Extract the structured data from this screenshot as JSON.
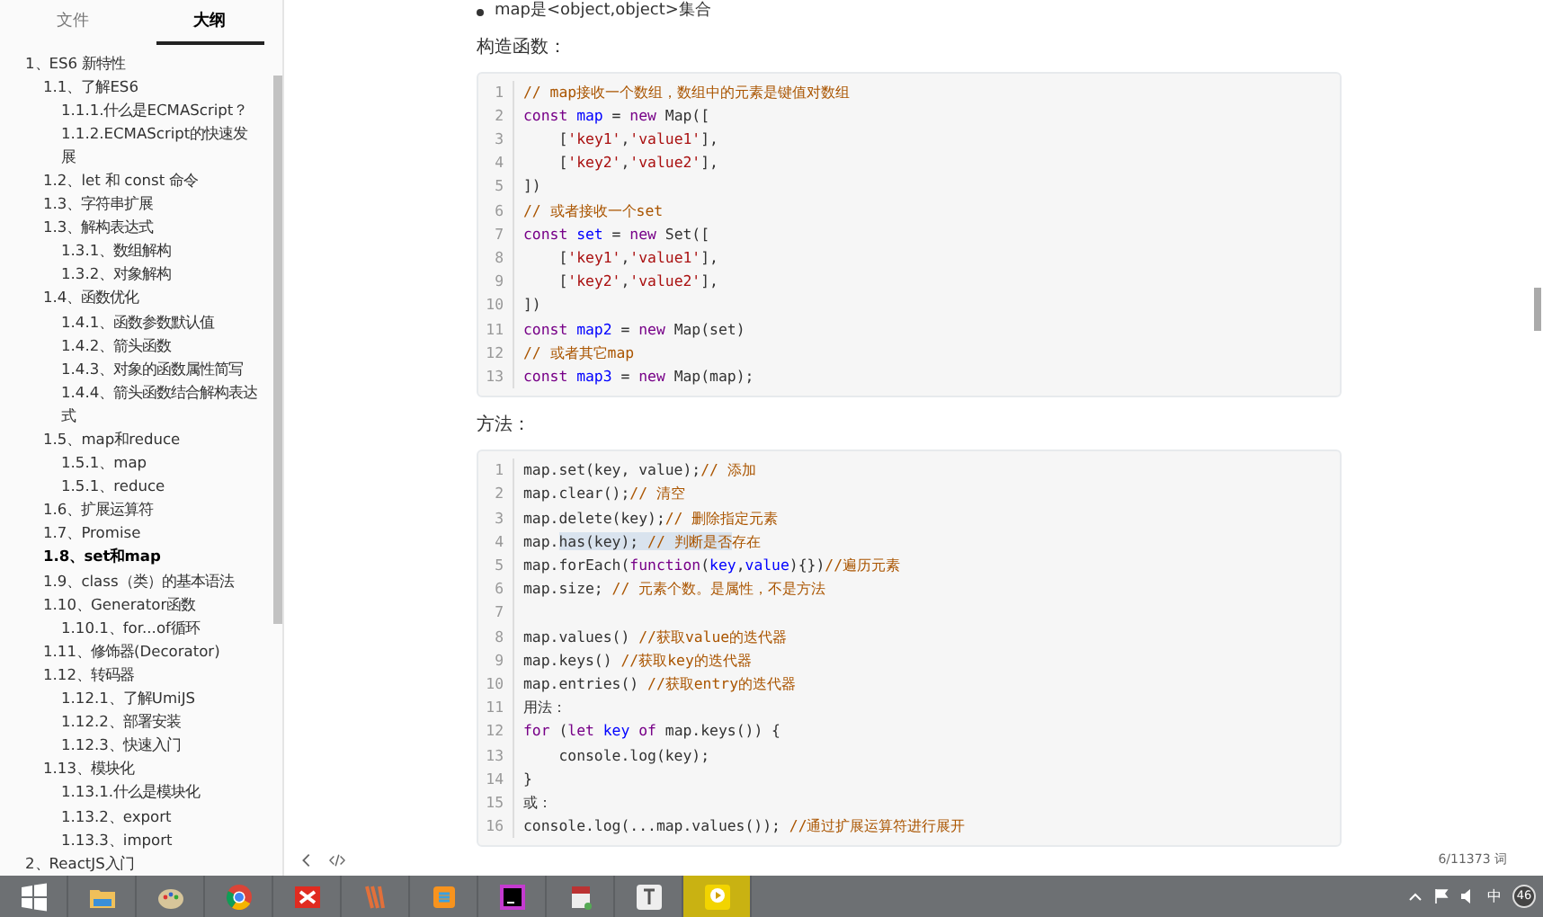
{
  "sidebar": {
    "tabs": [
      {
        "label": "文件",
        "selected": false
      },
      {
        "label": "大纲",
        "selected": true
      }
    ],
    "outline": [
      {
        "label": "1、ES6 新特性",
        "selected": false,
        "children": [
          {
            "label": "1.1、了解ES6",
            "selected": false,
            "children": [
              {
                "label": "1.1.1.什么是ECMAScript？",
                "selected": false
              },
              {
                "label": "1.1.2.ECMAScript的快速发展",
                "selected": false
              }
            ]
          },
          {
            "label": "1.2、let 和 const 命令",
            "selected": false
          },
          {
            "label": "1.3、字符串扩展",
            "selected": false
          },
          {
            "label": "1.3、解构表达式",
            "selected": false,
            "children": [
              {
                "label": "1.3.1、数组解构",
                "selected": false
              },
              {
                "label": "1.3.2、对象解构",
                "selected": false
              }
            ]
          },
          {
            "label": "1.4、函数优化",
            "selected": false,
            "children": [
              {
                "label": "1.4.1、函数参数默认值",
                "selected": false
              },
              {
                "label": "1.4.2、箭头函数",
                "selected": false
              },
              {
                "label": "1.4.3、对象的函数属性简写",
                "selected": false
              },
              {
                "label": "1.4.4、箭头函数结合解构表达式",
                "selected": false
              }
            ]
          },
          {
            "label": "1.5、map和reduce",
            "selected": false,
            "children": [
              {
                "label": "1.5.1、map",
                "selected": false
              },
              {
                "label": "1.5.1、reduce",
                "selected": false
              }
            ]
          },
          {
            "label": "1.6、扩展运算符",
            "selected": false
          },
          {
            "label": "1.7、Promise",
            "selected": false
          },
          {
            "label": "1.8、set和map",
            "selected": true
          },
          {
            "label": "1.9、class（类）的基本语法",
            "selected": false
          },
          {
            "label": "1.10、Generator函数",
            "selected": false,
            "children": [
              {
                "label": "1.10.1、for...of循环",
                "selected": false
              }
            ]
          },
          {
            "label": "1.11、修饰器(Decorator)",
            "selected": false
          },
          {
            "label": "1.12、转码器",
            "selected": false,
            "children": [
              {
                "label": "1.12.1、了解UmiJS",
                "selected": false
              },
              {
                "label": "1.12.2、部署安装",
                "selected": false
              },
              {
                "label": "1.12.3、快速入门",
                "selected": false
              }
            ]
          },
          {
            "label": "1.13、模块化",
            "selected": false,
            "children": [
              {
                "label": "1.13.1.什么是模块化",
                "selected": false
              },
              {
                "label": "1.13.2、export",
                "selected": false
              },
              {
                "label": "1.13.3、import",
                "selected": false
              }
            ]
          }
        ]
      },
      {
        "label": "2、ReactJS入门",
        "selected": false
      }
    ]
  },
  "document": {
    "bullet": "map是<object,object>集合",
    "sections": [
      {
        "heading": "构造函数：",
        "code": [
          {
            "number": "1",
            "tokens": [
              {
                "kind": "comment",
                "text": "// map接收一个数组，数组中的元素是键值对数组"
              }
            ]
          },
          {
            "number": "2",
            "tokens": [
              {
                "kind": "keyword",
                "text": "const "
              },
              {
                "kind": "def",
                "text": "map"
              },
              {
                "kind": "plain",
                "text": " = "
              },
              {
                "kind": "keyword",
                "text": "new"
              },
              {
                "kind": "plain",
                "text": " Map(["
              }
            ]
          },
          {
            "number": "3",
            "tokens": [
              {
                "kind": "plain",
                "text": "    ["
              },
              {
                "kind": "string",
                "text": "'key1'"
              },
              {
                "kind": "plain",
                "text": ","
              },
              {
                "kind": "string",
                "text": "'value1'"
              },
              {
                "kind": "plain",
                "text": "],"
              }
            ]
          },
          {
            "number": "4",
            "tokens": [
              {
                "kind": "plain",
                "text": "    ["
              },
              {
                "kind": "string",
                "text": "'key2'"
              },
              {
                "kind": "plain",
                "text": ","
              },
              {
                "kind": "string",
                "text": "'value2'"
              },
              {
                "kind": "plain",
                "text": "],"
              }
            ]
          },
          {
            "number": "5",
            "tokens": [
              {
                "kind": "plain",
                "text": "])"
              }
            ]
          },
          {
            "number": "6",
            "tokens": [
              {
                "kind": "comment",
                "text": "// 或者接收一个set"
              }
            ]
          },
          {
            "number": "7",
            "tokens": [
              {
                "kind": "keyword",
                "text": "const "
              },
              {
                "kind": "def",
                "text": "set"
              },
              {
                "kind": "plain",
                "text": " = "
              },
              {
                "kind": "keyword",
                "text": "new"
              },
              {
                "kind": "plain",
                "text": " Set(["
              }
            ]
          },
          {
            "number": "8",
            "tokens": [
              {
                "kind": "plain",
                "text": "    ["
              },
              {
                "kind": "string",
                "text": "'key1'"
              },
              {
                "kind": "plain",
                "text": ","
              },
              {
                "kind": "string",
                "text": "'value1'"
              },
              {
                "kind": "plain",
                "text": "],"
              }
            ]
          },
          {
            "number": "9",
            "tokens": [
              {
                "kind": "plain",
                "text": "    ["
              },
              {
                "kind": "string",
                "text": "'key2'"
              },
              {
                "kind": "plain",
                "text": ","
              },
              {
                "kind": "string",
                "text": "'value2'"
              },
              {
                "kind": "plain",
                "text": "],"
              }
            ]
          },
          {
            "number": "10",
            "tokens": [
              {
                "kind": "plain",
                "text": "])"
              }
            ]
          },
          {
            "number": "11",
            "tokens": [
              {
                "kind": "keyword",
                "text": "const "
              },
              {
                "kind": "def",
                "text": "map2"
              },
              {
                "kind": "plain",
                "text": " = "
              },
              {
                "kind": "keyword",
                "text": "new"
              },
              {
                "kind": "plain",
                "text": " Map(set)"
              }
            ]
          },
          {
            "number": "12",
            "tokens": [
              {
                "kind": "comment",
                "text": "// 或者其它map"
              }
            ]
          },
          {
            "number": "13",
            "tokens": [
              {
                "kind": "keyword",
                "text": "const "
              },
              {
                "kind": "def",
                "text": "map3"
              },
              {
                "kind": "plain",
                "text": " = "
              },
              {
                "kind": "keyword",
                "text": "new"
              },
              {
                "kind": "plain",
                "text": " Map(map);"
              }
            ]
          }
        ]
      },
      {
        "heading": "方法：",
        "code": [
          {
            "number": "1",
            "tokens": [
              {
                "kind": "plain",
                "text": "map.set(key, value);"
              },
              {
                "kind": "comment",
                "text": "// 添加"
              }
            ]
          },
          {
            "number": "2",
            "tokens": [
              {
                "kind": "plain",
                "text": "map.clear();"
              },
              {
                "kind": "comment",
                "text": "// 清空"
              }
            ]
          },
          {
            "number": "3",
            "tokens": [
              {
                "kind": "plain",
                "text": "map.delete(key);"
              },
              {
                "kind": "comment",
                "text": "// 删除指定元素"
              }
            ]
          },
          {
            "number": "4",
            "tokens": [
              {
                "kind": "plain",
                "text": "map."
              },
              {
                "kind": "plain",
                "text": "has(key); ",
                "selected": true
              },
              {
                "kind": "comment",
                "text": "// 判断是否",
                "selected": true
              },
              {
                "kind": "comment",
                "text": "存在"
              }
            ]
          },
          {
            "number": "5",
            "tokens": [
              {
                "kind": "plain",
                "text": "map.forEach("
              },
              {
                "kind": "keyword",
                "text": "function"
              },
              {
                "kind": "plain",
                "text": "("
              },
              {
                "kind": "def",
                "text": "key"
              },
              {
                "kind": "plain",
                "text": ","
              },
              {
                "kind": "def",
                "text": "value"
              },
              {
                "kind": "plain",
                "text": "){})"
              },
              {
                "kind": "comment",
                "text": "//遍历元素"
              }
            ]
          },
          {
            "number": "6",
            "tokens": [
              {
                "kind": "plain",
                "text": "map.size; "
              },
              {
                "kind": "comment",
                "text": "// 元素个数。是属性，不是方法"
              }
            ]
          },
          {
            "number": "7"
          },
          {
            "number": "8",
            "tokens": [
              {
                "kind": "plain",
                "text": "map.values() "
              },
              {
                "kind": "comment",
                "text": "//获取value的迭代器"
              }
            ]
          },
          {
            "number": "9",
            "tokens": [
              {
                "kind": "plain",
                "text": "map.keys() "
              },
              {
                "kind": "comment",
                "text": "//获取key的迭代器"
              }
            ]
          },
          {
            "number": "10",
            "tokens": [
              {
                "kind": "plain",
                "text": "map.entries() "
              },
              {
                "kind": "comment",
                "text": "//获取entry的迭代器"
              }
            ]
          },
          {
            "number": "11",
            "tokens": [
              {
                "kind": "plain",
                "text": "用法："
              }
            ]
          },
          {
            "number": "12",
            "tokens": [
              {
                "kind": "keyword",
                "text": "for"
              },
              {
                "kind": "plain",
                "text": " ("
              },
              {
                "kind": "keyword",
                "text": "let "
              },
              {
                "kind": "def",
                "text": "key"
              },
              {
                "kind": "keyword",
                "text": " of"
              },
              {
                "kind": "plain",
                "text": " map.keys()) {"
              }
            ]
          },
          {
            "number": "13",
            "tokens": [
              {
                "kind": "plain",
                "text": "    console.log(key);"
              }
            ]
          },
          {
            "number": "14",
            "tokens": [
              {
                "kind": "plain",
                "text": "}"
              }
            ]
          },
          {
            "number": "15",
            "tokens": [
              {
                "kind": "plain",
                "text": "或："
              }
            ]
          },
          {
            "number": "16",
            "tokens": [
              {
                "kind": "plain",
                "text": "console.log(...map.values()); "
              },
              {
                "kind": "comment",
                "text": "//通过扩展运算符进行展开"
              }
            ]
          }
        ]
      }
    ]
  },
  "footer": {
    "word_count": "6/11373 词"
  },
  "taskbar": {
    "ime": "中",
    "notification_count": "46"
  }
}
